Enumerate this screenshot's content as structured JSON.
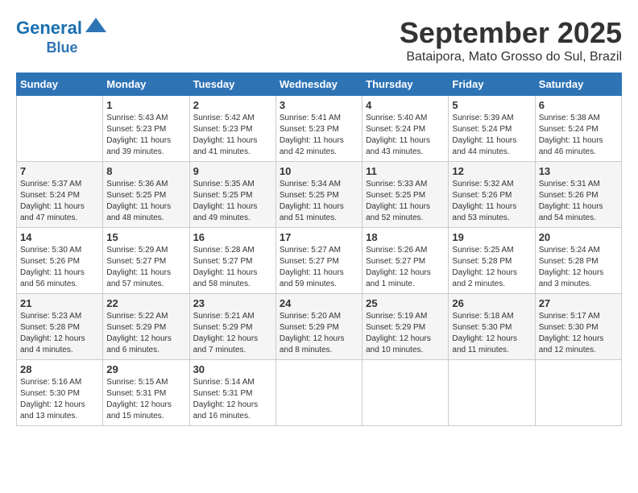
{
  "header": {
    "logo_line1": "General",
    "logo_line2": "Blue",
    "month": "September 2025",
    "location": "Bataipora, Mato Grosso do Sul, Brazil"
  },
  "weekdays": [
    "Sunday",
    "Monday",
    "Tuesday",
    "Wednesday",
    "Thursday",
    "Friday",
    "Saturday"
  ],
  "weeks": [
    [
      {
        "day": "",
        "info": ""
      },
      {
        "day": "1",
        "info": "Sunrise: 5:43 AM\nSunset: 5:23 PM\nDaylight: 11 hours\nand 39 minutes."
      },
      {
        "day": "2",
        "info": "Sunrise: 5:42 AM\nSunset: 5:23 PM\nDaylight: 11 hours\nand 41 minutes."
      },
      {
        "day": "3",
        "info": "Sunrise: 5:41 AM\nSunset: 5:23 PM\nDaylight: 11 hours\nand 42 minutes."
      },
      {
        "day": "4",
        "info": "Sunrise: 5:40 AM\nSunset: 5:24 PM\nDaylight: 11 hours\nand 43 minutes."
      },
      {
        "day": "5",
        "info": "Sunrise: 5:39 AM\nSunset: 5:24 PM\nDaylight: 11 hours\nand 44 minutes."
      },
      {
        "day": "6",
        "info": "Sunrise: 5:38 AM\nSunset: 5:24 PM\nDaylight: 11 hours\nand 46 minutes."
      }
    ],
    [
      {
        "day": "7",
        "info": "Sunrise: 5:37 AM\nSunset: 5:24 PM\nDaylight: 11 hours\nand 47 minutes."
      },
      {
        "day": "8",
        "info": "Sunrise: 5:36 AM\nSunset: 5:25 PM\nDaylight: 11 hours\nand 48 minutes."
      },
      {
        "day": "9",
        "info": "Sunrise: 5:35 AM\nSunset: 5:25 PM\nDaylight: 11 hours\nand 49 minutes."
      },
      {
        "day": "10",
        "info": "Sunrise: 5:34 AM\nSunset: 5:25 PM\nDaylight: 11 hours\nand 51 minutes."
      },
      {
        "day": "11",
        "info": "Sunrise: 5:33 AM\nSunset: 5:25 PM\nDaylight: 11 hours\nand 52 minutes."
      },
      {
        "day": "12",
        "info": "Sunrise: 5:32 AM\nSunset: 5:26 PM\nDaylight: 11 hours\nand 53 minutes."
      },
      {
        "day": "13",
        "info": "Sunrise: 5:31 AM\nSunset: 5:26 PM\nDaylight: 11 hours\nand 54 minutes."
      }
    ],
    [
      {
        "day": "14",
        "info": "Sunrise: 5:30 AM\nSunset: 5:26 PM\nDaylight: 11 hours\nand 56 minutes."
      },
      {
        "day": "15",
        "info": "Sunrise: 5:29 AM\nSunset: 5:27 PM\nDaylight: 11 hours\nand 57 minutes."
      },
      {
        "day": "16",
        "info": "Sunrise: 5:28 AM\nSunset: 5:27 PM\nDaylight: 11 hours\nand 58 minutes."
      },
      {
        "day": "17",
        "info": "Sunrise: 5:27 AM\nSunset: 5:27 PM\nDaylight: 11 hours\nand 59 minutes."
      },
      {
        "day": "18",
        "info": "Sunrise: 5:26 AM\nSunset: 5:27 PM\nDaylight: 12 hours\nand 1 minute."
      },
      {
        "day": "19",
        "info": "Sunrise: 5:25 AM\nSunset: 5:28 PM\nDaylight: 12 hours\nand 2 minutes."
      },
      {
        "day": "20",
        "info": "Sunrise: 5:24 AM\nSunset: 5:28 PM\nDaylight: 12 hours\nand 3 minutes."
      }
    ],
    [
      {
        "day": "21",
        "info": "Sunrise: 5:23 AM\nSunset: 5:28 PM\nDaylight: 12 hours\nand 4 minutes."
      },
      {
        "day": "22",
        "info": "Sunrise: 5:22 AM\nSunset: 5:29 PM\nDaylight: 12 hours\nand 6 minutes."
      },
      {
        "day": "23",
        "info": "Sunrise: 5:21 AM\nSunset: 5:29 PM\nDaylight: 12 hours\nand 7 minutes."
      },
      {
        "day": "24",
        "info": "Sunrise: 5:20 AM\nSunset: 5:29 PM\nDaylight: 12 hours\nand 8 minutes."
      },
      {
        "day": "25",
        "info": "Sunrise: 5:19 AM\nSunset: 5:29 PM\nDaylight: 12 hours\nand 10 minutes."
      },
      {
        "day": "26",
        "info": "Sunrise: 5:18 AM\nSunset: 5:30 PM\nDaylight: 12 hours\nand 11 minutes."
      },
      {
        "day": "27",
        "info": "Sunrise: 5:17 AM\nSunset: 5:30 PM\nDaylight: 12 hours\nand 12 minutes."
      }
    ],
    [
      {
        "day": "28",
        "info": "Sunrise: 5:16 AM\nSunset: 5:30 PM\nDaylight: 12 hours\nand 13 minutes."
      },
      {
        "day": "29",
        "info": "Sunrise: 5:15 AM\nSunset: 5:31 PM\nDaylight: 12 hours\nand 15 minutes."
      },
      {
        "day": "30",
        "info": "Sunrise: 5:14 AM\nSunset: 5:31 PM\nDaylight: 12 hours\nand 16 minutes."
      },
      {
        "day": "",
        "info": ""
      },
      {
        "day": "",
        "info": ""
      },
      {
        "day": "",
        "info": ""
      },
      {
        "day": "",
        "info": ""
      }
    ]
  ]
}
